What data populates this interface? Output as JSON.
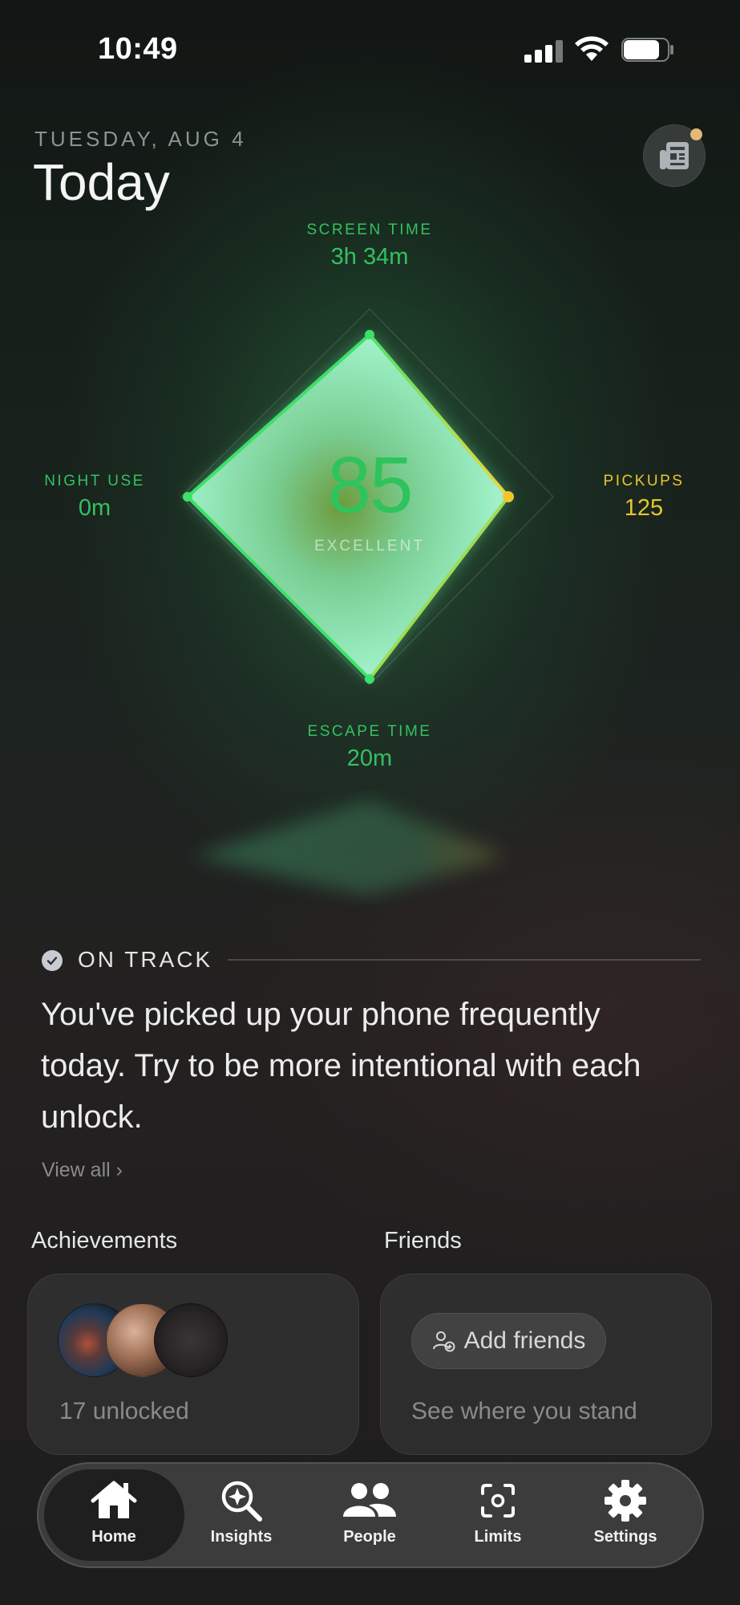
{
  "status_bar": {
    "time": "10:49"
  },
  "header": {
    "date": "TUESDAY, AUG 4",
    "title": "Today",
    "news_icon": "newspaper-icon",
    "news_badge_color": "#e5b878"
  },
  "score": {
    "value": "85",
    "label": "EXCELLENT",
    "color": "#2fc35c"
  },
  "metrics": {
    "screen_time": {
      "label": "SCREEN TIME",
      "value": "3h 34m"
    },
    "night_use": {
      "label": "NIGHT USE",
      "value": "0m"
    },
    "pickups": {
      "label": "PICKUPS",
      "value": "125"
    },
    "escape_time": {
      "label": "ESCAPE TIME",
      "value": "20m"
    },
    "accent_green": "#33c160",
    "accent_yellow": "#e6c62e"
  },
  "status": {
    "label": "ON TRACK",
    "icon": "check-circle-icon",
    "message": "You've picked up your phone frequently today. Try to be more intentional with each unlock.",
    "view_all": "View all ›"
  },
  "achievements": {
    "title": "Achievements",
    "summary": "17 unlocked"
  },
  "friends": {
    "title": "Friends",
    "add_button": "Add friends",
    "subtitle": "See where you stand"
  },
  "tabs": [
    {
      "label": "Home",
      "icon": "home-icon",
      "active": true
    },
    {
      "label": "Insights",
      "icon": "insights-search-icon",
      "active": false
    },
    {
      "label": "People",
      "icon": "people-icon",
      "active": false
    },
    {
      "label": "Limits",
      "icon": "limits-focus-icon",
      "active": false
    },
    {
      "label": "Settings",
      "icon": "gear-icon",
      "active": false
    }
  ]
}
